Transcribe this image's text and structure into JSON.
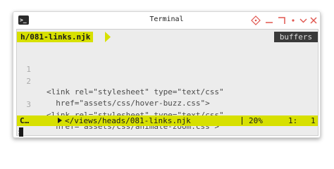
{
  "window": {
    "title": "Terminal",
    "app_icon_glyph": ">_",
    "controls": [
      "move-icon",
      "minimize-icon",
      "maximize-icon",
      "shade-icon",
      "close-icon"
    ]
  },
  "tabline": {
    "file": "h/081-links.njk",
    "buffers_label": "buffers"
  },
  "editor": {
    "lines": [
      {
        "num": "1",
        "text": ""
      },
      {
        "num": "2",
        "text": "<link rel=\"stylesheet\" type=\"text/css\""
      },
      {
        "num": "",
        "text": "  href=\"assets/css/hover-buzz.css\">"
      },
      {
        "num": "3",
        "text": "<link rel=\"stylesheet\" type=\"text/css\""
      },
      {
        "num": "",
        "text": "  href=\"assets/css/animate-zoom.css\">"
      }
    ]
  },
  "statusline": {
    "mode": "C…",
    "path": "</views/heads/081-links.njk",
    "percent": "20%",
    "line": "1:",
    "col": "1"
  },
  "cmdline": {
    "text": ":"
  },
  "colors": {
    "accent": "#d7e000",
    "terminal_bg": "#ececec",
    "control_red": "#e0564f"
  }
}
